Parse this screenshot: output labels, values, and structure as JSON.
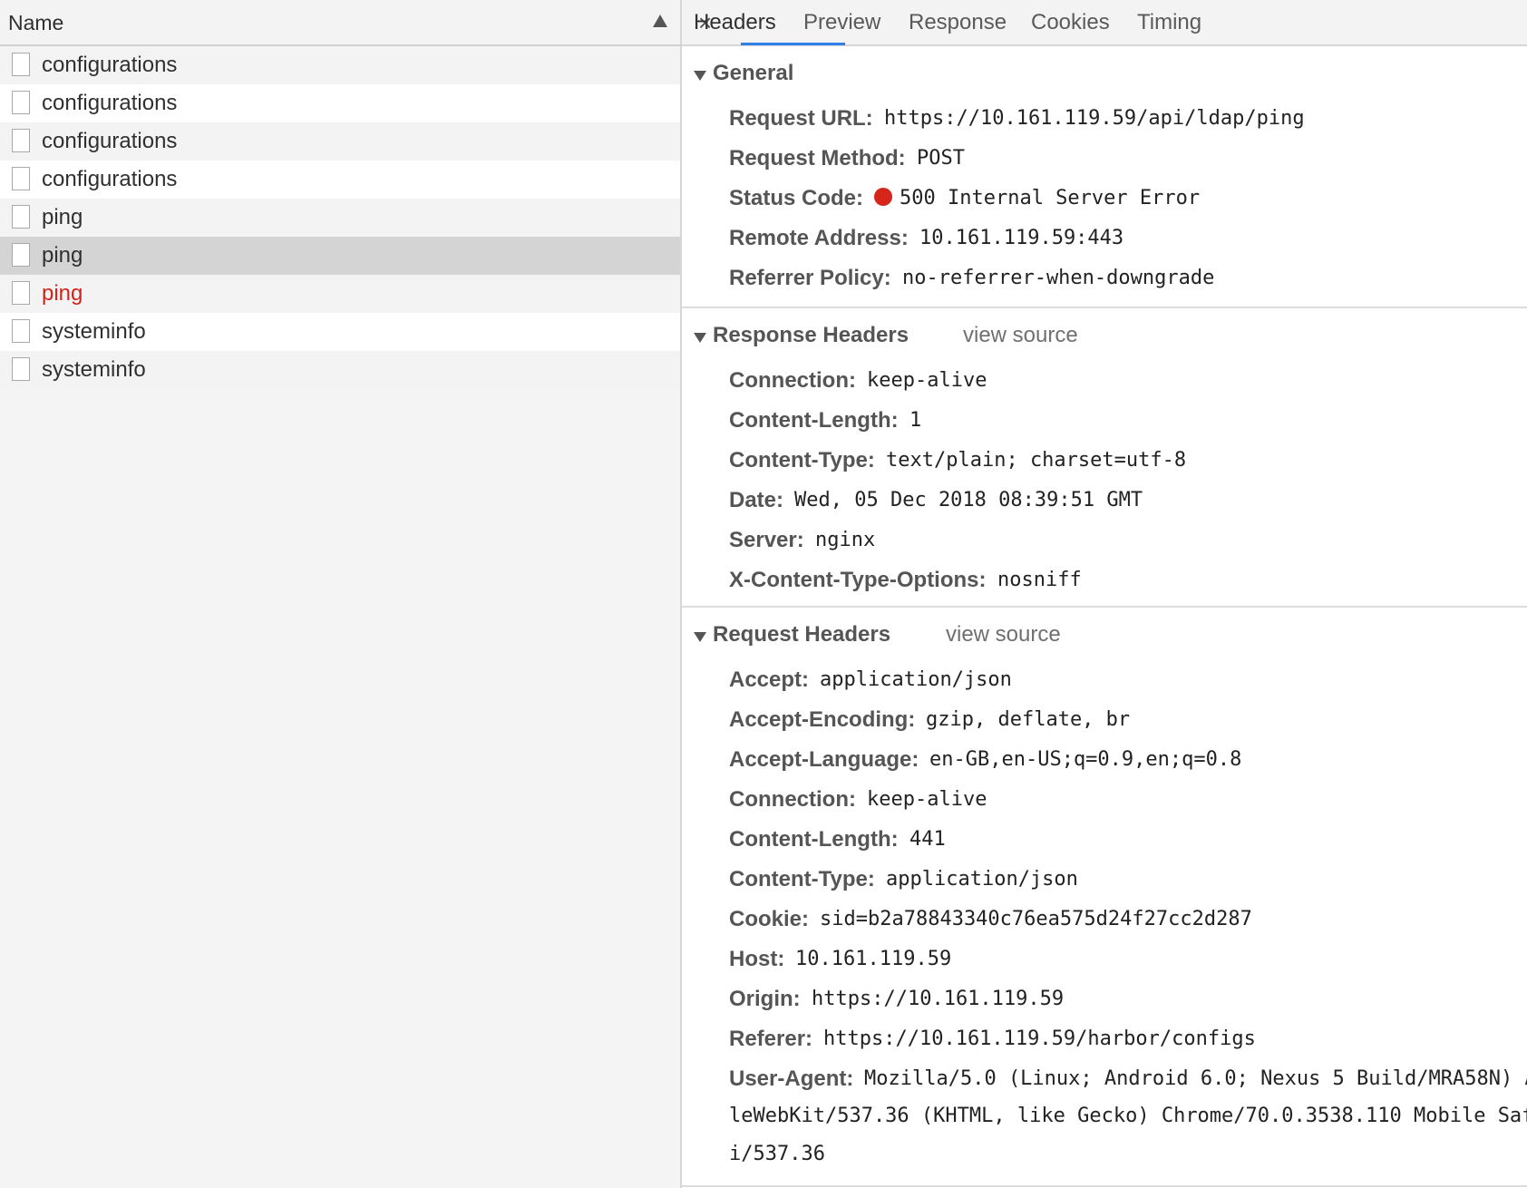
{
  "requests": {
    "column_name": "Name",
    "sort_icon": "sort-ascending-icon",
    "items": [
      {
        "label": "configurations",
        "status": "ok"
      },
      {
        "label": "configurations",
        "status": "ok"
      },
      {
        "label": "configurations",
        "status": "ok"
      },
      {
        "label": "configurations",
        "status": "ok"
      },
      {
        "label": "ping",
        "status": "ok"
      },
      {
        "label": "ping",
        "status": "ok",
        "selected": true
      },
      {
        "label": "ping",
        "status": "error"
      },
      {
        "label": "systeminfo",
        "status": "ok"
      },
      {
        "label": "systeminfo",
        "status": "ok"
      }
    ]
  },
  "tabs": {
    "close_symbol": "×",
    "items": [
      "Headers",
      "Preview",
      "Response",
      "Cookies",
      "Timing"
    ],
    "active": "Headers"
  },
  "general": {
    "title": "General",
    "fields": [
      {
        "key": "Request URL:",
        "value": "https://10.161.119.59/api/ldap/ping"
      },
      {
        "key": "Request Method:",
        "value": "POST"
      },
      {
        "key": "Status Code:",
        "value": "500 Internal Server Error",
        "status_dot_color": "#d6261c"
      },
      {
        "key": "Remote Address:",
        "value": "10.161.119.59:443"
      },
      {
        "key": "Referrer Policy:",
        "value": "no-referrer-when-downgrade"
      }
    ]
  },
  "response_headers": {
    "title": "Response Headers",
    "view_source": "view source",
    "fields": [
      {
        "key": "Connection:",
        "value": "keep-alive"
      },
      {
        "key": "Content-Length:",
        "value": "1"
      },
      {
        "key": "Content-Type:",
        "value": "text/plain; charset=utf-8"
      },
      {
        "key": "Date:",
        "value": "Wed, 05 Dec 2018 08:39:51 GMT"
      },
      {
        "key": "Server:",
        "value": "nginx"
      },
      {
        "key": "X-Content-Type-Options:",
        "value": "nosniff"
      }
    ]
  },
  "request_headers": {
    "title": "Request Headers",
    "view_source": "view source",
    "fields": [
      {
        "key": "Accept:",
        "value": "application/json"
      },
      {
        "key": "Accept-Encoding:",
        "value": "gzip, deflate, br"
      },
      {
        "key": "Accept-Language:",
        "value": "en-GB,en-US;q=0.9,en;q=0.8"
      },
      {
        "key": "Connection:",
        "value": "keep-alive"
      },
      {
        "key": "Content-Length:",
        "value": "441"
      },
      {
        "key": "Content-Type:",
        "value": "application/json"
      },
      {
        "key": "Cookie:",
        "value": "sid=b2a78843340c76ea575d24f27cc2d287"
      },
      {
        "key": "Host:",
        "value": "10.161.119.59"
      },
      {
        "key": "Origin:",
        "value": "https://10.161.119.59"
      },
      {
        "key": "Referer:",
        "value": "https://10.161.119.59/harbor/configs"
      },
      {
        "key": "User-Agent:",
        "value": "Mozilla/5.0 (Linux; Android 6.0; Nexus 5 Build/MRA58N) A",
        "continuation": [
          "leWebKit/537.36 (KHTML, like Gecko) Chrome/70.0.3538.110 Mobile Saf",
          "i/537.36"
        ]
      }
    ]
  },
  "colors": {
    "accent": "#2f7fe6",
    "error_text": "#d0231b",
    "selected_row": "#d4d4d4"
  }
}
